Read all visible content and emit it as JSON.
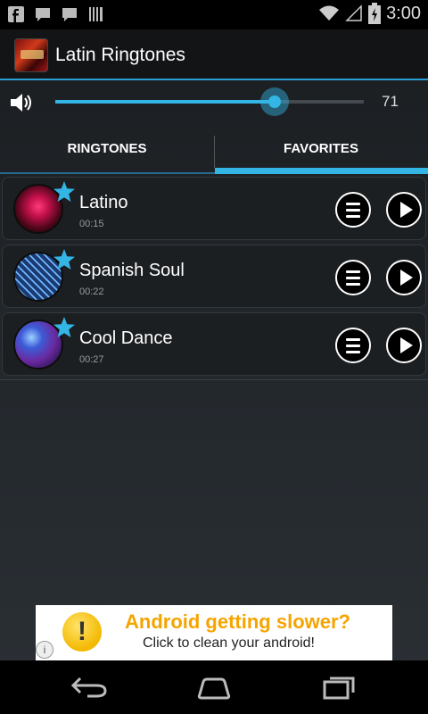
{
  "status_bar": {
    "left_icons": [
      "facebook-icon",
      "chat-icon",
      "chat-icon",
      "barcode-icon"
    ],
    "right_icons": [
      "wifi-icon",
      "signal-icon",
      "battery-charging-icon"
    ],
    "time": "3:00"
  },
  "app_bar": {
    "title": "Latin Ringtones",
    "icon": "app-icon"
  },
  "volume": {
    "icon": "speaker-icon",
    "level_percent": 71,
    "value_label": "71"
  },
  "tabs": [
    {
      "label": "RINGTONES",
      "selected": false
    },
    {
      "label": "FAVORITES",
      "selected": true
    }
  ],
  "ringtones": [
    {
      "title": "Latino",
      "duration": "00:15",
      "favorite": true,
      "thumb": "red"
    },
    {
      "title": "Spanish Soul",
      "duration": "00:22",
      "favorite": true,
      "thumb": "blue-grid"
    },
    {
      "title": "Cool Dance",
      "duration": "00:27",
      "favorite": true,
      "thumb": "disco"
    }
  ],
  "ad": {
    "title": "Android getting slower?",
    "subtitle": "Click to clean your android!",
    "bulb_symbol": "!",
    "info_symbol": "i"
  },
  "colors": {
    "accent": "#33b5e5",
    "star": "#33b5e5",
    "ad_title": "#f5a400"
  },
  "nav_bar": {
    "buttons": [
      "back-icon",
      "home-icon",
      "recents-icon"
    ]
  }
}
